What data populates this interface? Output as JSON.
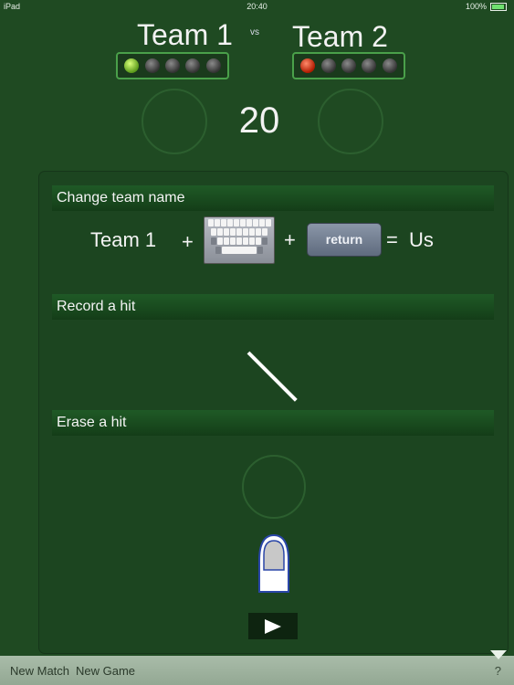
{
  "status_bar": {
    "device": "iPad",
    "time": "20:40",
    "battery": "100%"
  },
  "teams": {
    "left": {
      "name": "Team 1",
      "lights": [
        "green",
        "off",
        "off",
        "off",
        "off"
      ]
    },
    "vs": "vs",
    "right": {
      "name": "Team 2",
      "lights": [
        "red",
        "off",
        "off",
        "off",
        "off"
      ]
    }
  },
  "score": "20",
  "help": {
    "change_name": {
      "title": "Change team name",
      "example_from": "Team 1",
      "plus": "+",
      "return_label": "return",
      "equals": "=",
      "example_to": "Us"
    },
    "record_hit": {
      "title": "Record a hit"
    },
    "erase_hit": {
      "title": "Erase a hit"
    },
    "play_icon": "play-icon"
  },
  "toolbar": {
    "new_match": "New Match",
    "new_game": "New Game",
    "help": "?"
  },
  "colors": {
    "background": "#1f4a22",
    "panel": "#1c4520",
    "toolbar": "#a9bca9",
    "light_green": "#8fd63a",
    "light_red": "#d02a10"
  }
}
